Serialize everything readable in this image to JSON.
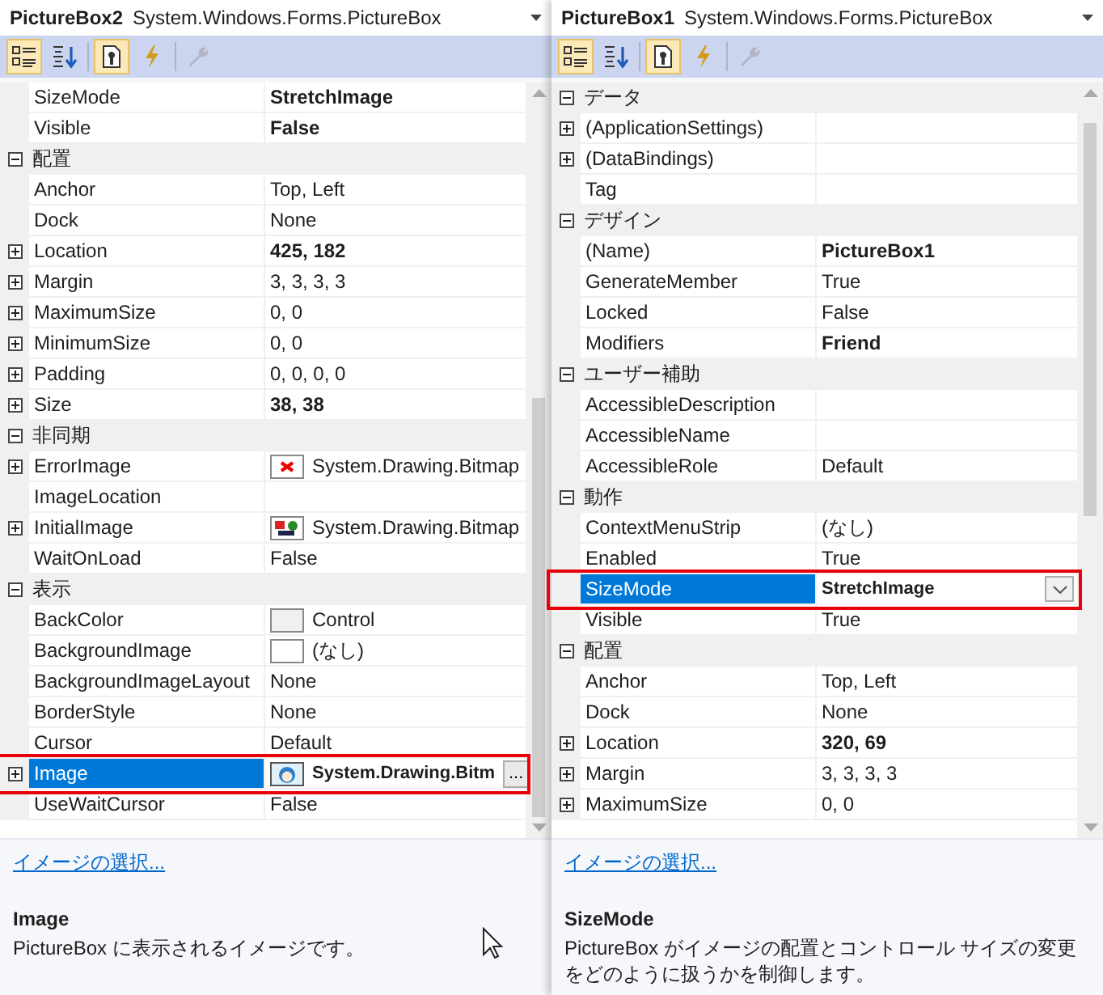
{
  "panels": [
    {
      "object_name": "PictureBox2",
      "object_type": "System.Windows.Forms.PictureBox",
      "toolbar": [
        {
          "kind": "categorized",
          "selected": true,
          "disabled": false
        },
        {
          "kind": "alphabetical",
          "selected": false,
          "disabled": false
        },
        {
          "kind": "properties",
          "selected": true,
          "disabled": false
        },
        {
          "kind": "events",
          "selected": false,
          "disabled": false
        },
        {
          "kind": "pages",
          "selected": false,
          "disabled": true
        }
      ],
      "rows": [
        {
          "kind": "property",
          "name": "SizeMode",
          "value": "StretchImage",
          "bold": true,
          "expandable": false,
          "selected": false
        },
        {
          "kind": "property",
          "name": "Visible",
          "value": "False",
          "bold": true,
          "expandable": false,
          "selected": false
        },
        {
          "kind": "category",
          "label": "配置",
          "expanded": true
        },
        {
          "kind": "property",
          "name": "Anchor",
          "value": "Top, Left",
          "bold": false,
          "expandable": false,
          "selected": false
        },
        {
          "kind": "property",
          "name": "Dock",
          "value": "None",
          "bold": false,
          "expandable": false,
          "selected": false
        },
        {
          "kind": "property",
          "name": "Location",
          "value": "425, 182",
          "bold": true,
          "expandable": true,
          "selected": false
        },
        {
          "kind": "property",
          "name": "Margin",
          "value": "3, 3, 3, 3",
          "bold": false,
          "expandable": true,
          "selected": false
        },
        {
          "kind": "property",
          "name": "MaximumSize",
          "value": "0, 0",
          "bold": false,
          "expandable": true,
          "selected": false
        },
        {
          "kind": "property",
          "name": "MinimumSize",
          "value": "0, 0",
          "bold": false,
          "expandable": true,
          "selected": false
        },
        {
          "kind": "property",
          "name": "Padding",
          "value": "0, 0, 0, 0",
          "bold": false,
          "expandable": true,
          "selected": false
        },
        {
          "kind": "property",
          "name": "Size",
          "value": "38, 38",
          "bold": true,
          "expandable": true,
          "selected": false
        },
        {
          "kind": "category",
          "label": "非同期",
          "expanded": true
        },
        {
          "kind": "property",
          "name": "ErrorImage",
          "value": "System.Drawing.Bitmap",
          "icon": {
            "kind": "error"
          },
          "bold": false,
          "expandable": true,
          "selected": false
        },
        {
          "kind": "property",
          "name": "ImageLocation",
          "expandable": false,
          "selected": false
        },
        {
          "kind": "property",
          "name": "InitialImage",
          "value": "System.Drawing.Bitmap",
          "icon": {
            "kind": "initial"
          },
          "bold": false,
          "expandable": true,
          "selected": false
        },
        {
          "kind": "property",
          "name": "WaitOnLoad",
          "value": "False",
          "bold": false,
          "expandable": false,
          "selected": false
        },
        {
          "kind": "category",
          "label": "表示",
          "expanded": true
        },
        {
          "kind": "property",
          "name": "BackColor",
          "value": "Control",
          "icon": {
            "kind": "swatch"
          },
          "bold": false,
          "expandable": false,
          "selected": false
        },
        {
          "kind": "property",
          "name": "BackgroundImage",
          "value": "(なし)",
          "icon": {
            "kind": "blank"
          },
          "bold": false,
          "expandable": false,
          "selected": false
        },
        {
          "kind": "property",
          "name": "BackgroundImageLayout",
          "value": "None",
          "bold": false,
          "expandable": false,
          "selected": false
        },
        {
          "kind": "property",
          "name": "BorderStyle",
          "value": "None",
          "bold": false,
          "expandable": false,
          "selected": false
        },
        {
          "kind": "property",
          "name": "Cursor",
          "value": "Default",
          "bold": false,
          "expandable": false,
          "selected": false
        },
        {
          "kind": "property",
          "name": "Image",
          "value": "System.Drawing.Bitm",
          "icon": {
            "kind": "thumbnail"
          },
          "bold": true,
          "expandable": true,
          "selected": true,
          "editor": {
            "kind": "ellipsis",
            "label": "..."
          }
        },
        {
          "kind": "property",
          "name": "UseWaitCursor",
          "value": "False",
          "bold": false,
          "expandable": false,
          "selected": false
        }
      ],
      "link": "イメージの選択...",
      "description_title": "Image",
      "description": "PictureBox に表示されるイメージです。",
      "pointer": true
    },
    {
      "object_name": "PictureBox1",
      "object_type": "System.Windows.Forms.PictureBox",
      "toolbar": [
        {
          "kind": "categorized",
          "selected": true,
          "disabled": false
        },
        {
          "kind": "alphabetical",
          "selected": false,
          "disabled": false
        },
        {
          "kind": "properties",
          "selected": true,
          "disabled": false
        },
        {
          "kind": "events",
          "selected": false,
          "disabled": false
        },
        {
          "kind": "pages",
          "selected": false,
          "disabled": true
        }
      ],
      "rows": [
        {
          "kind": "category",
          "label": "データ",
          "expanded": true
        },
        {
          "kind": "property",
          "name": "(ApplicationSettings)",
          "expandable": true,
          "selected": false
        },
        {
          "kind": "property",
          "name": "(DataBindings)",
          "expandable": true,
          "selected": false
        },
        {
          "kind": "property",
          "name": "Tag",
          "expandable": false,
          "selected": false
        },
        {
          "kind": "category",
          "label": "デザイン",
          "expanded": true
        },
        {
          "kind": "property",
          "name": "(Name)",
          "value": "PictureBox1",
          "bold": true,
          "expandable": false,
          "selected": false
        },
        {
          "kind": "property",
          "name": "GenerateMember",
          "value": "True",
          "bold": false,
          "expandable": false,
          "selected": false
        },
        {
          "kind": "property",
          "name": "Locked",
          "value": "False",
          "bold": false,
          "expandable": false,
          "selected": false
        },
        {
          "kind": "property",
          "name": "Modifiers",
          "value": "Friend",
          "bold": true,
          "expandable": false,
          "selected": false
        },
        {
          "kind": "category",
          "label": "ユーザー補助",
          "expanded": true
        },
        {
          "kind": "property",
          "name": "AccessibleDescription",
          "expandable": false,
          "selected": false
        },
        {
          "kind": "property",
          "name": "AccessibleName",
          "expandable": false,
          "selected": false
        },
        {
          "kind": "property",
          "name": "AccessibleRole",
          "value": "Default",
          "bold": false,
          "expandable": false,
          "selected": false
        },
        {
          "kind": "category",
          "label": "動作",
          "expanded": true
        },
        {
          "kind": "property",
          "name": "ContextMenuStrip",
          "value": "(なし)",
          "bold": false,
          "expandable": false,
          "selected": false
        },
        {
          "kind": "property",
          "name": "Enabled",
          "value": "True",
          "bold": false,
          "expandable": false,
          "selected": false
        },
        {
          "kind": "property",
          "name": "SizeMode",
          "value": "StretchImage",
          "bold": true,
          "expandable": false,
          "selected": true,
          "editor": {
            "kind": "dropdown"
          }
        },
        {
          "kind": "property",
          "name": "Visible",
          "value": "True",
          "bold": false,
          "expandable": false,
          "selected": false
        },
        {
          "kind": "category",
          "label": "配置",
          "expanded": true
        },
        {
          "kind": "property",
          "name": "Anchor",
          "value": "Top, Left",
          "bold": false,
          "expandable": false,
          "selected": false
        },
        {
          "kind": "property",
          "name": "Dock",
          "value": "None",
          "bold": false,
          "expandable": false,
          "selected": false
        },
        {
          "kind": "property",
          "name": "Location",
          "value": "320, 69",
          "bold": true,
          "expandable": true,
          "selected": false
        },
        {
          "kind": "property",
          "name": "Margin",
          "value": "3, 3, 3, 3",
          "bold": false,
          "expandable": true,
          "selected": false
        },
        {
          "kind": "property",
          "name": "MaximumSize",
          "value": "0, 0",
          "bold": false,
          "expandable": true,
          "selected": false
        }
      ],
      "link": "イメージの選択...",
      "description_title": "SizeMode",
      "description": "PictureBox がイメージの配置とコントロール サイズの変更をどのように扱うかを制御します。",
      "pointer": false
    }
  ]
}
